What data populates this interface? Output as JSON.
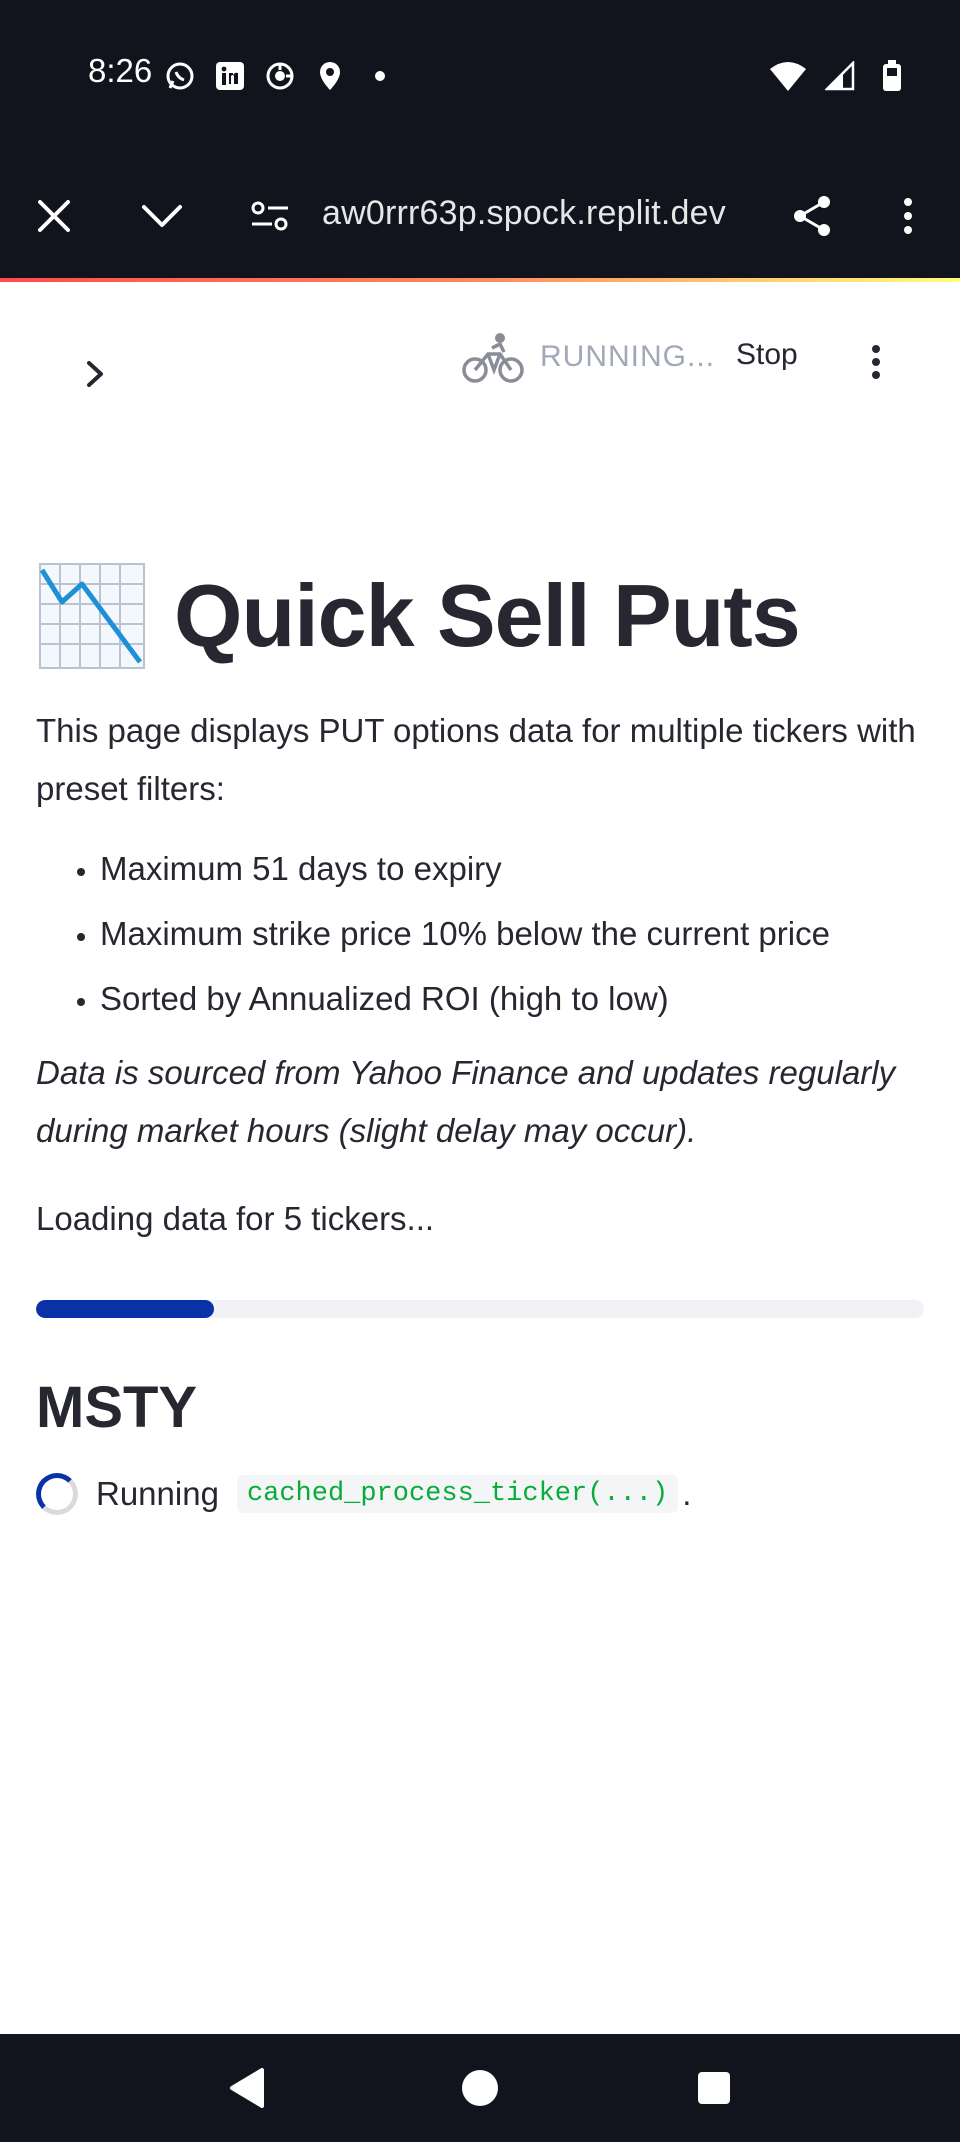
{
  "status_bar": {
    "time": "8:26",
    "left_icons": [
      "whatsapp-icon",
      "linkedin-icon",
      "ai-app-icon",
      "location-pin-icon",
      "dot-icon"
    ],
    "right_icons": [
      "wifi-icon",
      "signal-icon",
      "battery-icon"
    ]
  },
  "browser": {
    "url": "aw0rrr63p.spock.replit.dev",
    "buttons": [
      "close-icon",
      "chevron-down-icon",
      "site-settings-icon",
      "share-icon",
      "more-vert-icon"
    ]
  },
  "app_header": {
    "status": "RUNNING...",
    "stop_label": "Stop"
  },
  "page": {
    "title_emoji": "chart-decreasing-icon",
    "title": "Quick Sell Puts",
    "description": "This page displays PUT options data for multiple tickers with preset filters:",
    "filters": [
      "Maximum 51 days to expiry",
      "Maximum strike price 10% below the current price",
      "Sorted by Annualized ROI (high to low)"
    ],
    "note": "Data is sourced from Yahoo Finance and updates regularly during market hours (slight delay may occur).",
    "loading": "Loading data for 5 tickers...",
    "progress": 0.2,
    "ticker": "MSTY",
    "running_prefix": "Running",
    "running_code": "cached_process_ticker(...)",
    "running_suffix": "."
  },
  "colors": {
    "accent": "#0a32a8",
    "code_green": "#09ab3b",
    "text": "#262730",
    "system_bar": "#11141d"
  }
}
